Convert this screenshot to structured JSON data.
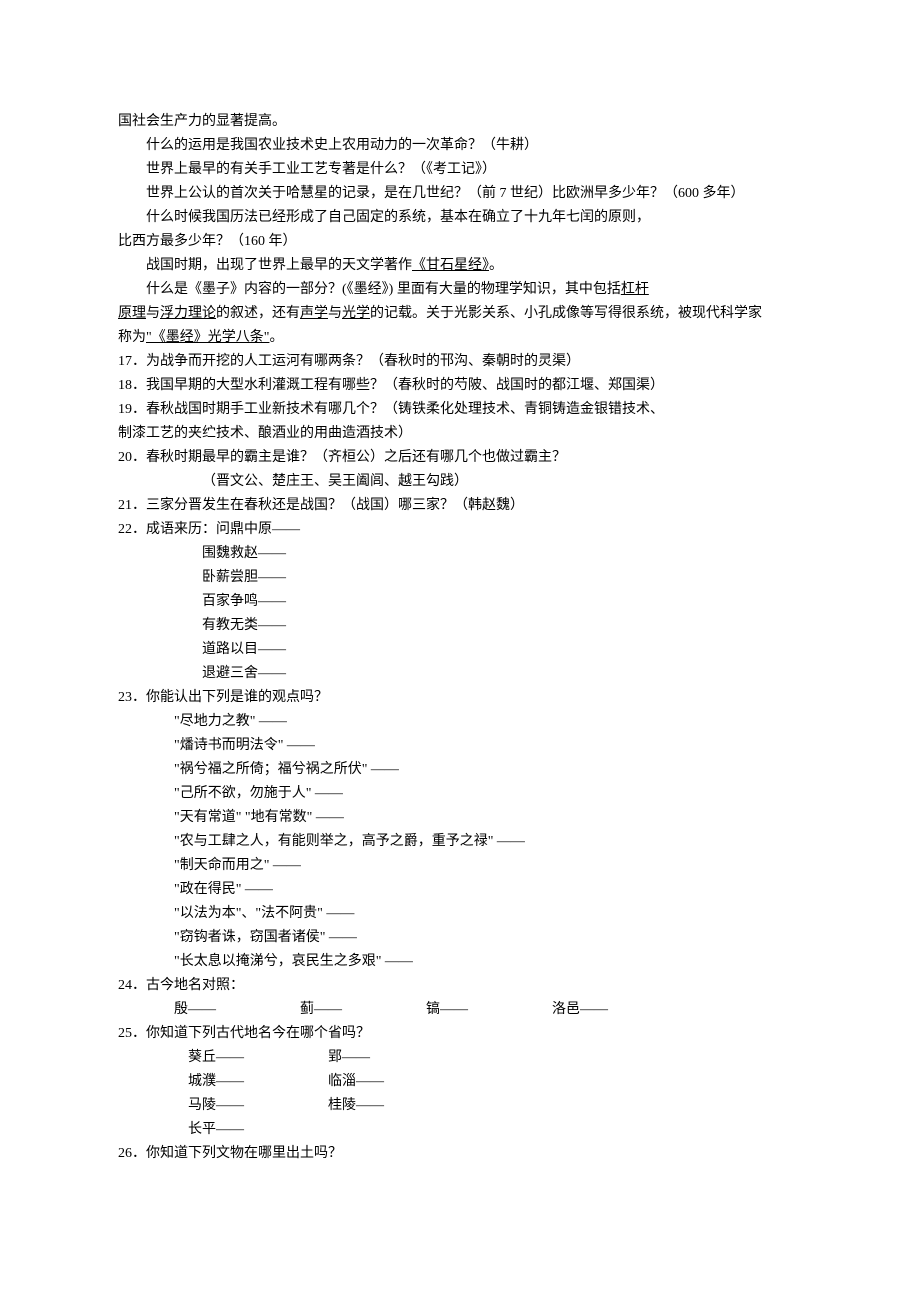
{
  "lines": [
    {
      "cls": "line",
      "text": "国社会生产力的显著提高。"
    },
    {
      "cls": "line indent1",
      "text": "什么的运用是我国农业技术史上农用动力的一次革命？（牛耕）"
    },
    {
      "cls": "line indent1",
      "text": "世界上最早的有关手工业工艺专著是什么？（《考工记》）"
    },
    {
      "cls": "line indent1",
      "text": "世界上公认的首次关于哈慧星的记录，是在几世纪？（前 7 世纪）比欧洲早多少年？（600 多年）"
    },
    {
      "cls": "line indent1",
      "text": "什么时候我国历法已经形成了自己固定的系统，基本在确立了十九年七闰的原则，"
    },
    {
      "cls": "line",
      "text": "比西方最多少年？（160 年）"
    },
    {
      "cls": "line indent1",
      "html": "战国时期，出现了世界上最早的天文学著作<span class='u'>《甘石星经》</span>。"
    },
    {
      "cls": "line indent1",
      "html": "什么是《墨子》内容的一部分？(《墨经》) 里面有大量的物理学知识，其中包括<span class='u'>杠杆</span>"
    },
    {
      "cls": "line",
      "html": "<span class='u'>原理</span>与<span class='u'>浮力理论</span>的叙述，还有<span class='u'>声学</span>与<span class='u'>光学</span>的记载。关于光影关系、小孔成像等写得很系统，被现代科学家"
    },
    {
      "cls": "line",
      "html": "称为<span class='u'>\"《墨经》光学八条\"</span>。"
    },
    {
      "cls": "line",
      "text": "17．为战争而开挖的人工运河有哪两条？（春秋时的邗沟、秦朝时的灵渠）"
    },
    {
      "cls": "line",
      "text": "18．我国早期的大型水利灌溉工程有哪些？（春秋时的芍陂、战国时的都江堰、郑国渠）"
    },
    {
      "cls": "line",
      "text": "19．春秋战国时期手工业新技术有哪几个？（铸铁柔化处理技术、青铜铸造金银错技术、"
    },
    {
      "cls": "line",
      "text": "制漆工艺的夹纻技术、酿酒业的用曲造酒技术）"
    },
    {
      "cls": "line",
      "text": "20．春秋时期最早的霸主是谁？（齐桓公）之后还有哪几个也做过霸主？"
    },
    {
      "cls": "line indent2",
      "text": "（晋文公、楚庄王、吴王阖闾、越王勾践）"
    },
    {
      "cls": "line",
      "text": "21．三家分晋发生在春秋还是战国？（战国）哪三家？（韩赵魏）"
    },
    {
      "cls": "line",
      "text": "22．成语来历：问鼎中原——"
    },
    {
      "cls": "line indent2",
      "text": "围魏救赵——"
    },
    {
      "cls": "line indent2",
      "text": "卧薪尝胆——"
    },
    {
      "cls": "line indent2",
      "text": "百家争鸣——"
    },
    {
      "cls": "line indent2",
      "text": "有教无类——"
    },
    {
      "cls": "line indent2",
      "text": "道路以目——"
    },
    {
      "cls": "line indent2",
      "text": "退避三舍——"
    },
    {
      "cls": "line",
      "text": "23．你能认出下列是谁的观点吗？"
    },
    {
      "cls": "line indent3",
      "text": "\"尽地力之教\" ——"
    },
    {
      "cls": "line indent3",
      "text": "\"燔诗书而明法令\" ——"
    },
    {
      "cls": "line indent3",
      "text": "\"祸兮福之所倚；福兮祸之所伏\" ——"
    },
    {
      "cls": "line indent3",
      "text": "\"己所不欲，勿施于人\" ——"
    },
    {
      "cls": "line indent3",
      "text": "\"天有常道\" \"地有常数\" ——"
    },
    {
      "cls": "line indent3",
      "text": "\"农与工肆之人，有能则举之，高予之爵，重予之禄\" ——"
    },
    {
      "cls": "line indent3",
      "text": "\"制天命而用之\" ——"
    },
    {
      "cls": "line indent3",
      "text": "\"政在得民\" ——"
    },
    {
      "cls": "line indent3",
      "text": "\"以法为本\"、\"法不阿贵\" ——"
    },
    {
      "cls": "line indent3",
      "text": "\"窃钩者诛，窃国者诸侯\" ——"
    },
    {
      "cls": "line indent3",
      "text": "\"长太息以掩涕兮，哀民生之多艰\" ——"
    },
    {
      "cls": "line",
      "text": "24．古今地名对照："
    },
    {
      "cls": "line indent3",
      "html": "殷——<span class='wide-gap2'></span>蓟——<span class='wide-gap2'></span>镐——<span class='wide-gap2'></span>洛邑——"
    },
    {
      "cls": "line",
      "text": "25．你知道下列古代地名今在哪个省吗？"
    },
    {
      "cls": "line indent4",
      "html": "葵丘——<span class='wide-gap2'></span>郢——"
    },
    {
      "cls": "line indent4",
      "html": "城濮——<span class='wide-gap2'></span>临淄——"
    },
    {
      "cls": "line indent4",
      "html": "马陵——<span class='wide-gap2'></span>桂陵——"
    },
    {
      "cls": "line indent4",
      "text": "长平——"
    },
    {
      "cls": "line",
      "text": "26．你知道下列文物在哪里出土吗？"
    }
  ]
}
